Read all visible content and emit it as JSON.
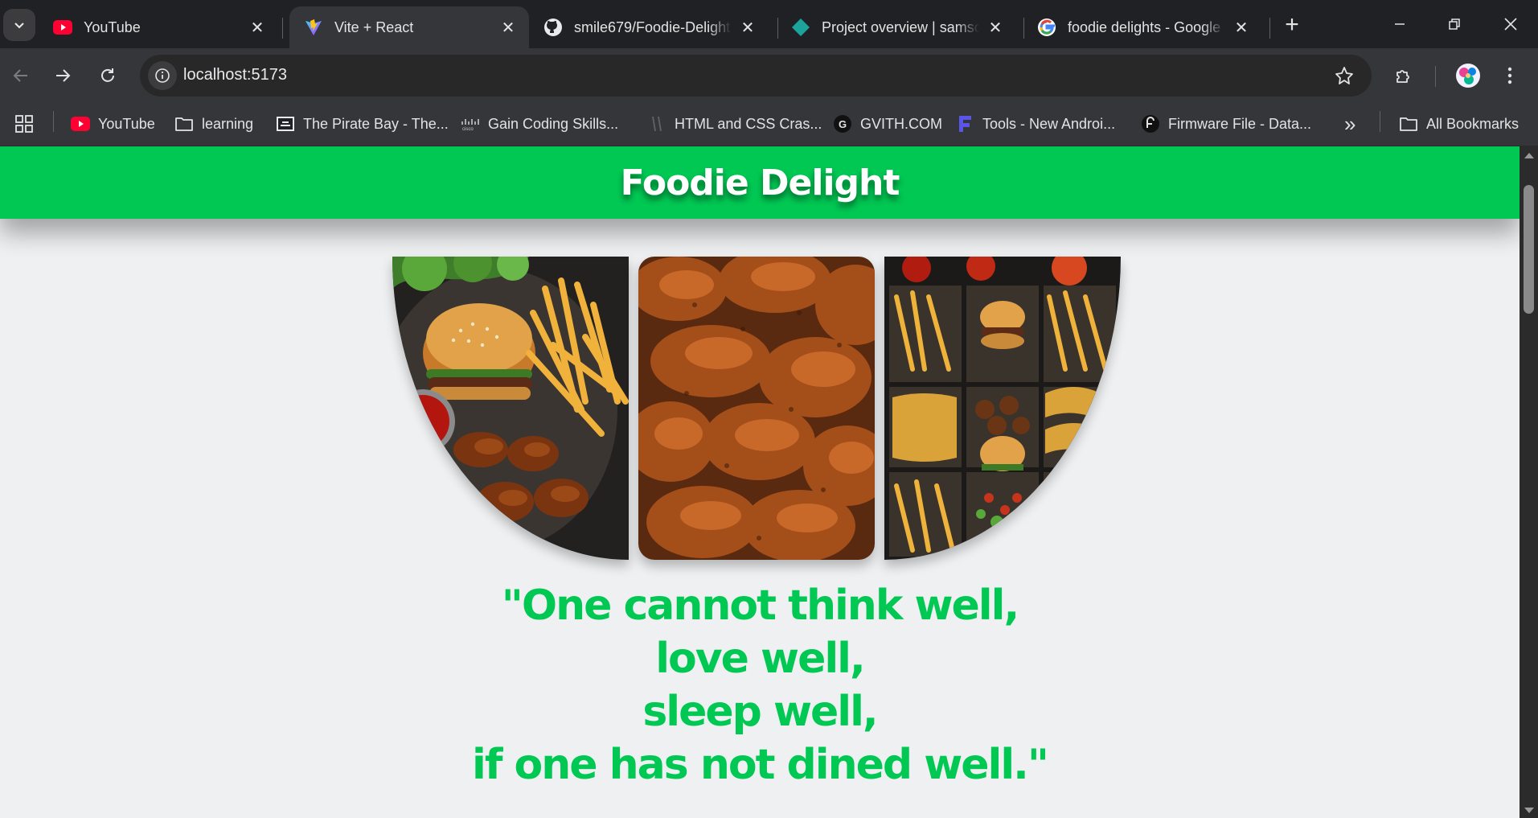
{
  "tabs": [
    {
      "title": "YouTube",
      "icon": "youtube-icon",
      "active": false
    },
    {
      "title": "Vite + React",
      "icon": "vite-icon",
      "active": true
    },
    {
      "title": "smile679/Foodie-Delight",
      "icon": "github-icon",
      "active": false
    },
    {
      "title": "Project overview | samson",
      "icon": "diamond-icon",
      "active": false
    },
    {
      "title": "foodie delights - Google",
      "icon": "google-icon",
      "active": false
    }
  ],
  "tab_close_glyph": "✕",
  "new_tab_glyph": "+",
  "address": {
    "url": "localhost:5173"
  },
  "bookmarks": [
    {
      "label": "YouTube",
      "icon": "youtube-icon"
    },
    {
      "label": "learning",
      "icon": "folder-icon"
    },
    {
      "label": "The Pirate Bay - The...",
      "icon": "pirate-bay-icon"
    },
    {
      "label": "Gain Coding Skills...",
      "icon": "cisco-icon"
    },
    {
      "label": "HTML and CSS Cras...",
      "icon": "page-icon"
    },
    {
      "label": "GVITH.COM",
      "icon": "gvith-icon"
    },
    {
      "label": "Tools - New Androi...",
      "icon": "f-logo-icon"
    },
    {
      "label": "Firmware File - Data...",
      "icon": "firmware-icon"
    }
  ],
  "bookmarks_overflow": "»",
  "all_bookmarks": "All Bookmarks",
  "page": {
    "title": "Foodie Delight",
    "quote_lines": [
      "\"One cannot think well,",
      "love well,",
      "sleep well,",
      "if one has not dined well.\""
    ],
    "images": [
      {
        "subject": "burger, fries and wings platter"
      },
      {
        "subject": "fried chicken wings"
      },
      {
        "subject": "fast food tray with fries, burgers and tacos"
      }
    ]
  },
  "colors": {
    "accent": "#00c853",
    "page_bg": "#eef0f2",
    "chrome_dark": "#202124",
    "chrome_toolbar": "#35363a"
  }
}
